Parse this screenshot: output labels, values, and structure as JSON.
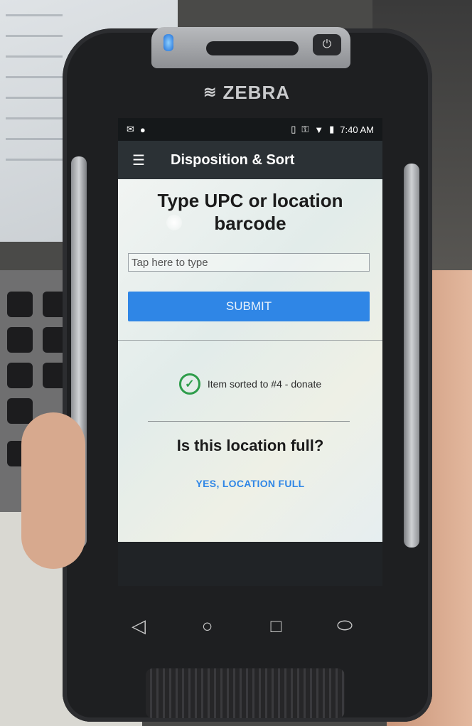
{
  "device": {
    "brand": "ZEBRA"
  },
  "status_bar": {
    "left_icons": [
      "gmail-icon",
      "messaging-icon"
    ],
    "right_icons": [
      "vibrate-icon",
      "vpn-key-icon",
      "wifi-icon",
      "battery-icon"
    ],
    "time": "7:40 AM"
  },
  "app_bar": {
    "menu_icon": "hamburger-menu-icon",
    "title": "Disposition & Sort"
  },
  "scan": {
    "heading": "Type UPC or location barcode",
    "input_placeholder": "Tap here to type",
    "input_value": "",
    "submit_label": "SUBMIT"
  },
  "result": {
    "status_icon": "check-circle-icon",
    "status_color": "#2e9d4b",
    "message": "Item sorted to #4 - donate"
  },
  "location": {
    "question": "Is this location full?",
    "confirm_label": "YES, LOCATION FULL"
  },
  "nav": {
    "back_icon": "back-triangle-icon",
    "home_icon": "home-circle-icon",
    "recents_icon": "recents-square-icon",
    "extra_icon": "pill-icon"
  },
  "colors": {
    "accent": "#2f86e6",
    "app_bar": "#2b3135",
    "success": "#2e9d4b"
  }
}
